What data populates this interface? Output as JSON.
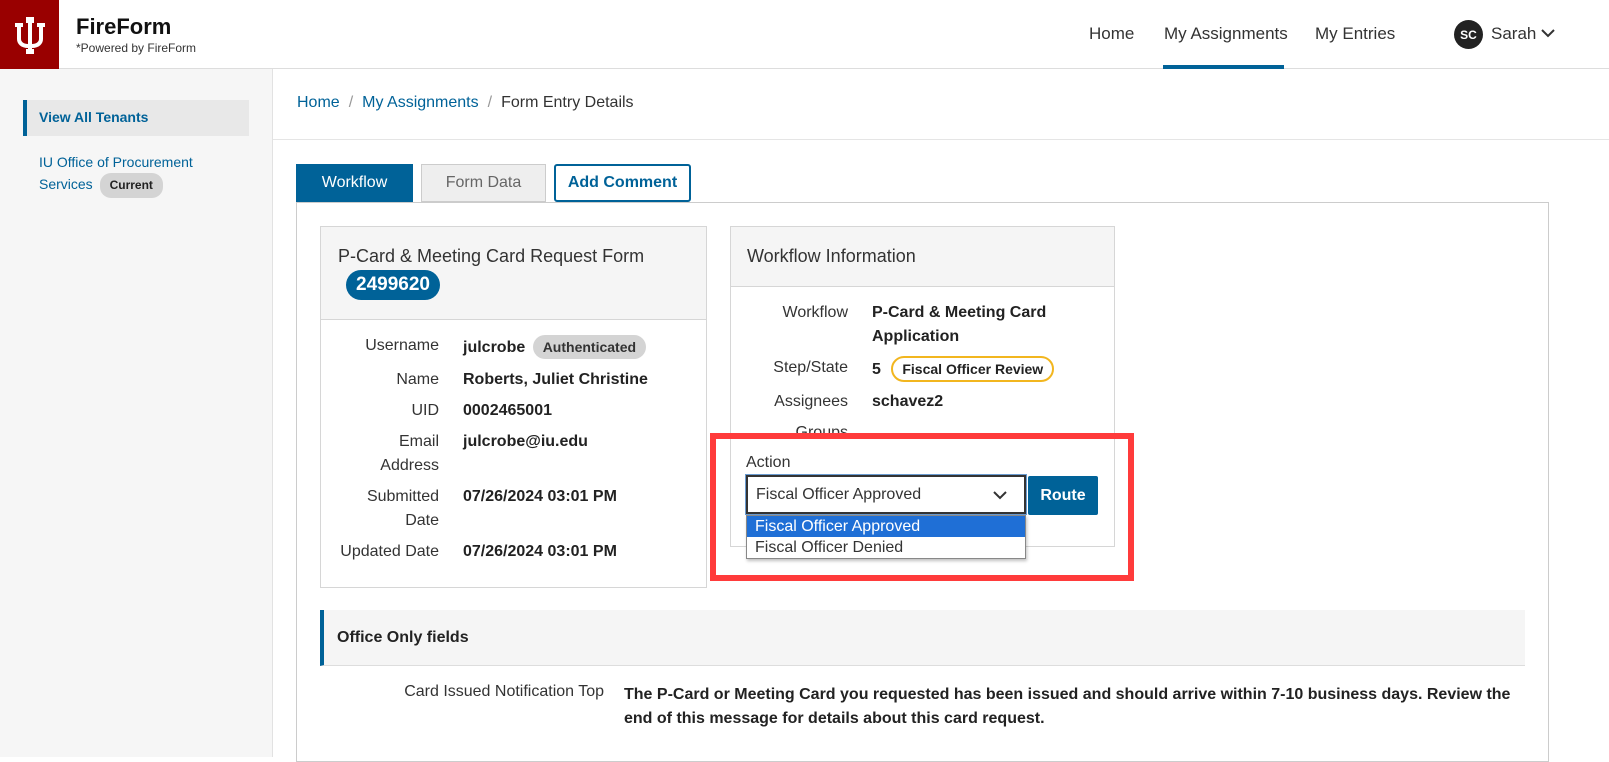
{
  "header": {
    "brand_title": "FireForm",
    "brand_subtitle": "*Powered by FireForm",
    "nav": [
      {
        "label": "Home"
      },
      {
        "label": "My Assignments",
        "active": true
      },
      {
        "label": "My Entries"
      }
    ],
    "user": {
      "initials": "SC",
      "name": "Sarah"
    }
  },
  "sidebar": {
    "active_item": "View All Tenants",
    "tenant_link": "IU Office of Procurement Services",
    "tenant_badge": "Current"
  },
  "breadcrumb": {
    "items": [
      "Home",
      "My Assignments",
      "Form Entry Details"
    ],
    "separator": "/"
  },
  "tabs": {
    "workflow": "Workflow",
    "form_data": "Form Data",
    "add_comment": "Add Comment"
  },
  "form_card": {
    "title": "P-Card & Meeting Card Request Form",
    "entry_id": "2499620",
    "fields": {
      "username_label": "Username",
      "username_value": "julcrobe",
      "username_badge": "Authenticated",
      "name_label": "Name",
      "name_value": "Roberts, Juliet Christine",
      "uid_label": "UID",
      "uid_value": "0002465001",
      "email_label_1": "Email",
      "email_label_2": "Address",
      "email_value": "julcrobe@iu.edu",
      "submitted_label_1": "Submitted",
      "submitted_label_2": "Date",
      "submitted_value": "07/26/2024 03:01 PM",
      "updated_label": "Updated Date",
      "updated_value": "07/26/2024 03:01 PM"
    }
  },
  "workflow_card": {
    "title": "Workflow Information",
    "workflow_label": "Workflow",
    "workflow_value_1": "P-Card & Meeting Card",
    "workflow_value_2": "Application",
    "step_label": "Step/State",
    "step_number": "5",
    "step_state": "Fiscal Officer Review",
    "assignees_label": "Assignees",
    "assignees_value": "schavez2",
    "groups_label": "Groups",
    "action_label": "Action",
    "action_selected": "Fiscal Officer Approved",
    "action_options": [
      "Fiscal Officer Approved",
      "Fiscal Officer Denied"
    ],
    "route_button": "Route"
  },
  "office_only": {
    "heading": "Office Only fields",
    "field_label": "Card Issued Notification Top",
    "field_value": "The P-Card or Meeting Card you requested has been issued and should arrive within 7-10 business days. Review the end of this message for details about this card request."
  },
  "colors": {
    "brand_red": "#990000",
    "primary_blue": "#006298",
    "highlight_red": "#ff3b3b",
    "state_badge_border": "#f2b61f"
  }
}
